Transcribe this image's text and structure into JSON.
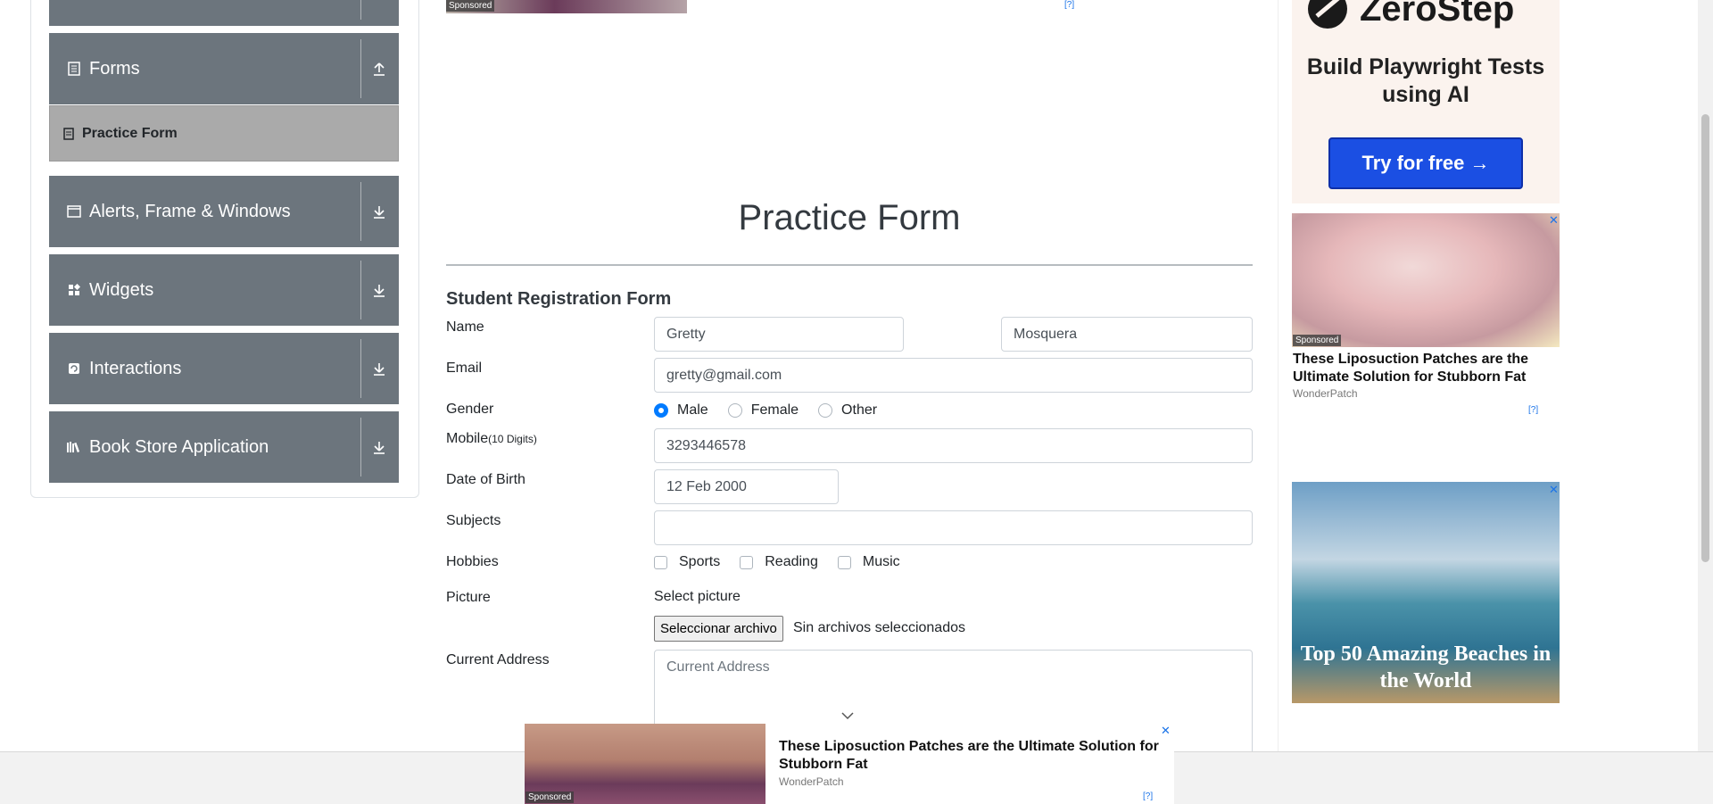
{
  "sidebar": {
    "groups": [
      {
        "label": "Forms",
        "icon": "form-icon",
        "toggle": "collapse-icon"
      },
      {
        "label": "Alerts, Frame & Windows",
        "icon": "window-icon",
        "toggle": "expand-icon"
      },
      {
        "label": "Widgets",
        "icon": "widgets-icon",
        "toggle": "expand-icon"
      },
      {
        "label": "Interactions",
        "icon": "interactions-icon",
        "toggle": "expand-icon"
      },
      {
        "label": "Book Store Application",
        "icon": "books-icon",
        "toggle": "expand-icon"
      }
    ],
    "active_item": {
      "label": "Practice Form",
      "icon": "practice-form-icon"
    }
  },
  "main": {
    "sponsored": "Sponsored",
    "adchoice": "[?]",
    "title": "Practice Form",
    "form_heading": "Student Registration Form",
    "fields": {
      "name_label": "Name",
      "first_name": "Gretty",
      "last_name": "Mosquera",
      "email_label": "Email",
      "email": "gretty@gmail.com",
      "gender_label": "Gender",
      "gender_options": [
        "Male",
        "Female",
        "Other"
      ],
      "gender_selected": "Male",
      "mobile_label": "Mobile",
      "mobile_hint": "(10 Digits)",
      "mobile": "3293446578",
      "dob_label": "Date of Birth",
      "dob": "12 Feb 2000",
      "subjects_label": "Subjects",
      "subjects": "",
      "hobbies_label": "Hobbies",
      "hobbies": [
        "Sports",
        "Reading",
        "Music"
      ],
      "picture_label": "Picture",
      "select_picture": "Select picture",
      "file_button": "Seleccionar archivo",
      "file_status": "Sin archivos seleccionados",
      "address_label": "Current Address",
      "address_placeholder": "Current Address"
    }
  },
  "ads": {
    "zerostep": {
      "brand": "ZeroStep",
      "tagline": "Build Playwright Tests using AI",
      "button": "Try for free →"
    },
    "ad1": {
      "sponsored": "Sponsored",
      "title": "These Liposuction Patches are the Ultimate Solution for Stubborn Fat",
      "brand": "WonderPatch",
      "adchoice": "[?]"
    },
    "ad2": {
      "text": "Top 50 Amazing Beaches in the World"
    },
    "bottom": {
      "sponsored": "Sponsored",
      "title": "These Liposuction Patches are the Ultimate Solution for Stubborn Fat",
      "brand": "WonderPatch",
      "adchoice": "[?]"
    }
  }
}
